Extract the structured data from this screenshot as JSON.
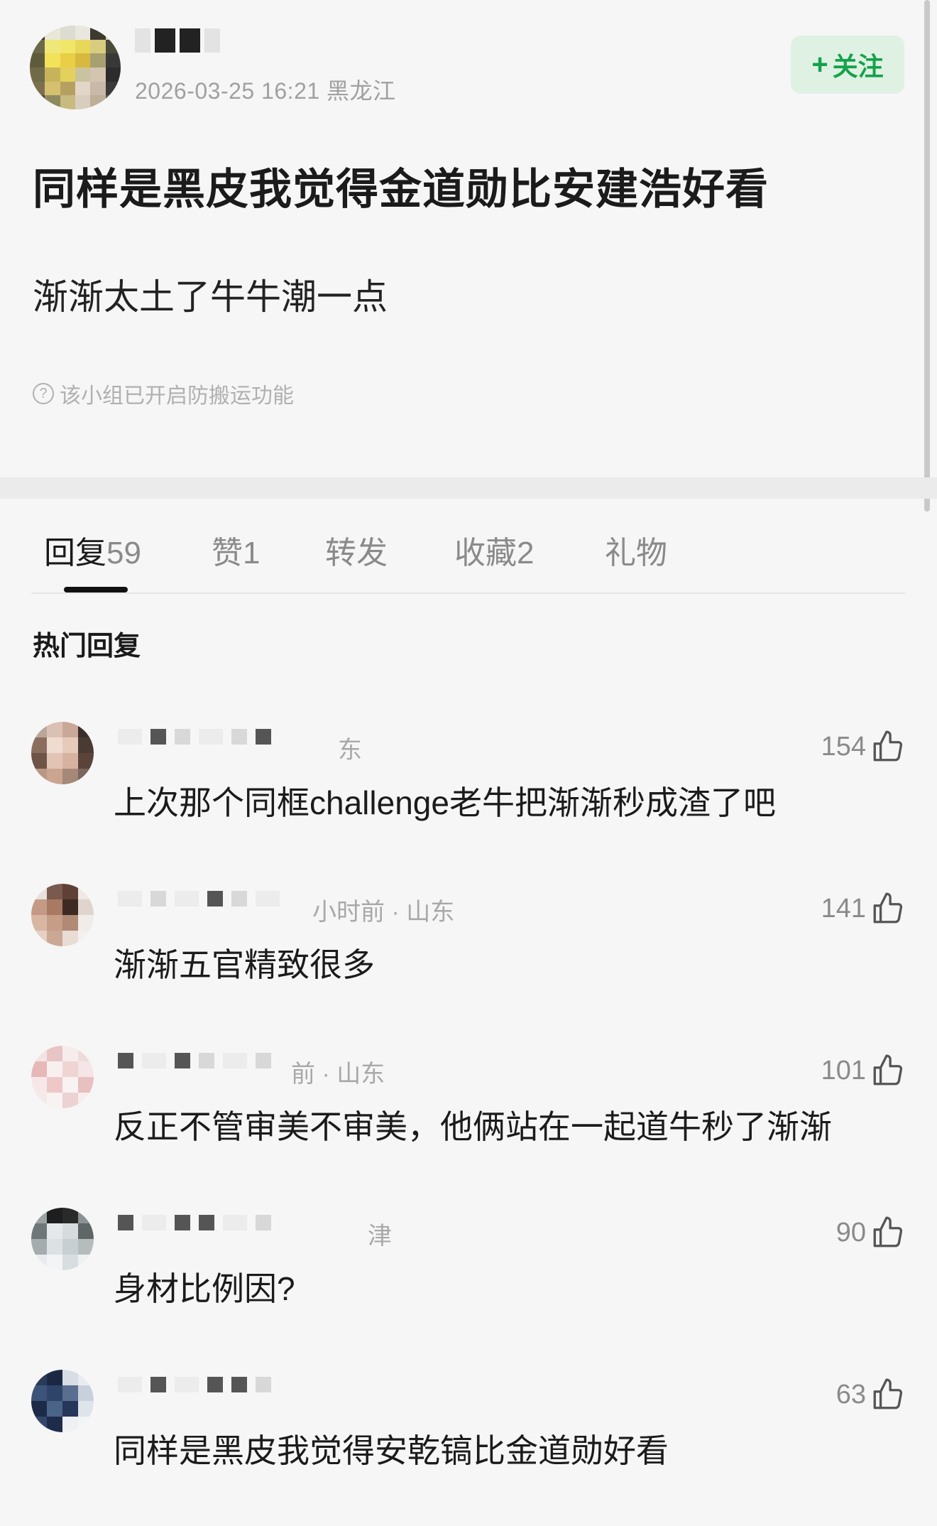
{
  "post": {
    "meta": "2026-03-25 16:21 黑龙江",
    "follow_label": "关注",
    "follow_icon": "plus-icon",
    "title": "同样是黑皮我觉得金道勋比安建浩好看",
    "body": "渐渐太土了牛牛潮一点",
    "notice": "该小组已开启防搬运功能",
    "notice_icon": "question-circle-icon"
  },
  "tabs": [
    {
      "label": "回复",
      "count": "59"
    },
    {
      "label": "赞",
      "count": "1"
    },
    {
      "label": "转发",
      "count": ""
    },
    {
      "label": "收藏",
      "count": "2"
    },
    {
      "label": "礼物",
      "count": ""
    }
  ],
  "section_title": "热门回复",
  "comments": [
    {
      "meta": "东",
      "likes": "154",
      "text": "上次那个同框challenge老牛把渐渐秒成渣了吧"
    },
    {
      "meta": "小时前 · 山东",
      "likes": "141",
      "text": "渐渐五官精致很多"
    },
    {
      "meta": "前 · 山东",
      "likes": "101",
      "text": "反正不管审美不审美，他俩站在一起道牛秒了渐渐"
    },
    {
      "meta": "津",
      "likes": "90",
      "text": "身材比例因?"
    },
    {
      "meta": "",
      "likes": "63",
      "text": "同样是黑皮我觉得安乾镐比金道勋好看"
    }
  ],
  "colors": {
    "accent_green": "#14a24a",
    "follow_bg": "#dff1e3",
    "muted_text": "#a0a0a0"
  }
}
